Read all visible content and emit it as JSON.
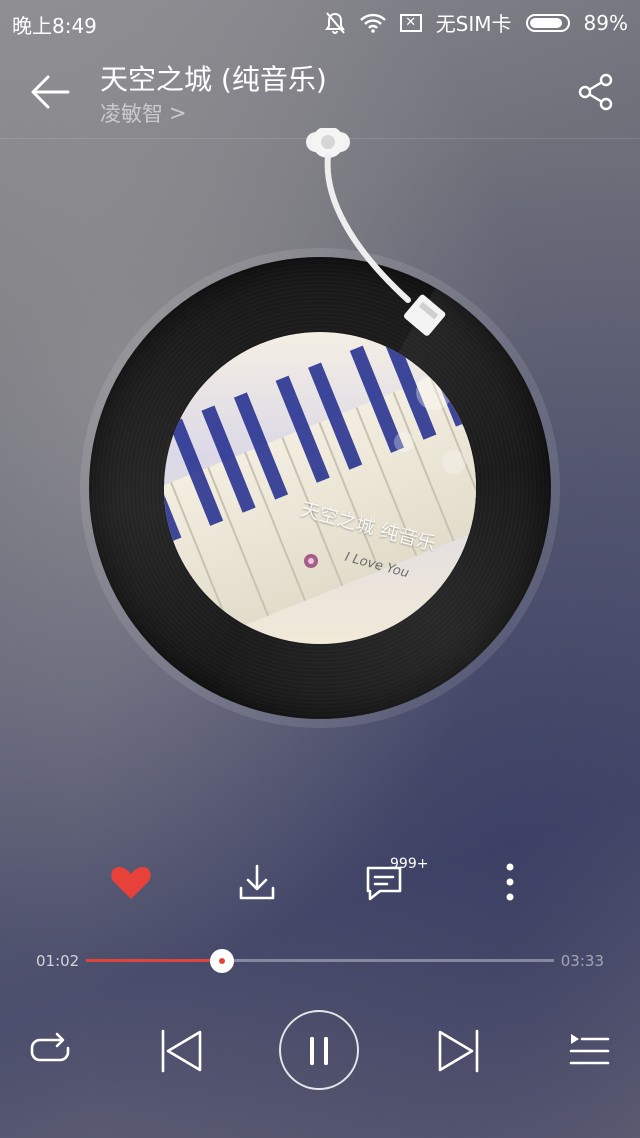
{
  "status_bar": {
    "time": "晚上8:49",
    "sim": "无SIM卡",
    "battery_percent": "89%",
    "battery_level": 0.89,
    "icons": [
      "mute-icon",
      "wifi-icon",
      "no-sim-icon",
      "battery-icon"
    ]
  },
  "header": {
    "title": "天空之城 (纯音乐)",
    "artist": "凌敏智",
    "artist_chevron": ">"
  },
  "cover": {
    "overlay_title": "天空之城 纯音乐",
    "overlay_sub": "I Love You"
  },
  "actions": {
    "comment_badge": "999+",
    "items": [
      "like-icon",
      "download-icon",
      "comment-icon",
      "more-icon"
    ],
    "liked": true
  },
  "playback": {
    "current_time": "01:02",
    "total_time": "03:33",
    "progress": 0.29
  },
  "controls": [
    "repeat-icon",
    "previous-icon",
    "pause-icon",
    "next-icon",
    "playlist-icon"
  ],
  "colors": {
    "accent": "#e0443b",
    "like": "#e8413a"
  }
}
